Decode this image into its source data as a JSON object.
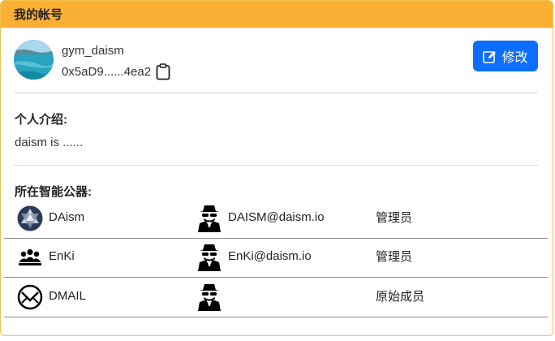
{
  "header": {
    "title": "我的帐号"
  },
  "profile": {
    "username": "gym_daism",
    "address": "0x5aD9......4ea2",
    "edit_label": "修改"
  },
  "intro": {
    "title": "个人介绍:",
    "text": "daism is ......"
  },
  "daos": {
    "title": "所在智能公器:",
    "rows": [
      {
        "name": "DAism",
        "email": "DAISM@daism.io",
        "role": "管理员",
        "icon": "daism-logo-icon"
      },
      {
        "name": "EnKi",
        "email": "EnKi@daism.io",
        "role": "管理员",
        "icon": "enki-people-icon"
      },
      {
        "name": "DMAIL",
        "email": "",
        "role": "原始成员",
        "icon": "dmail-envelope-icon"
      }
    ]
  },
  "colors": {
    "header_bg": "#fbb034",
    "button_bg": "#0d6efd"
  }
}
